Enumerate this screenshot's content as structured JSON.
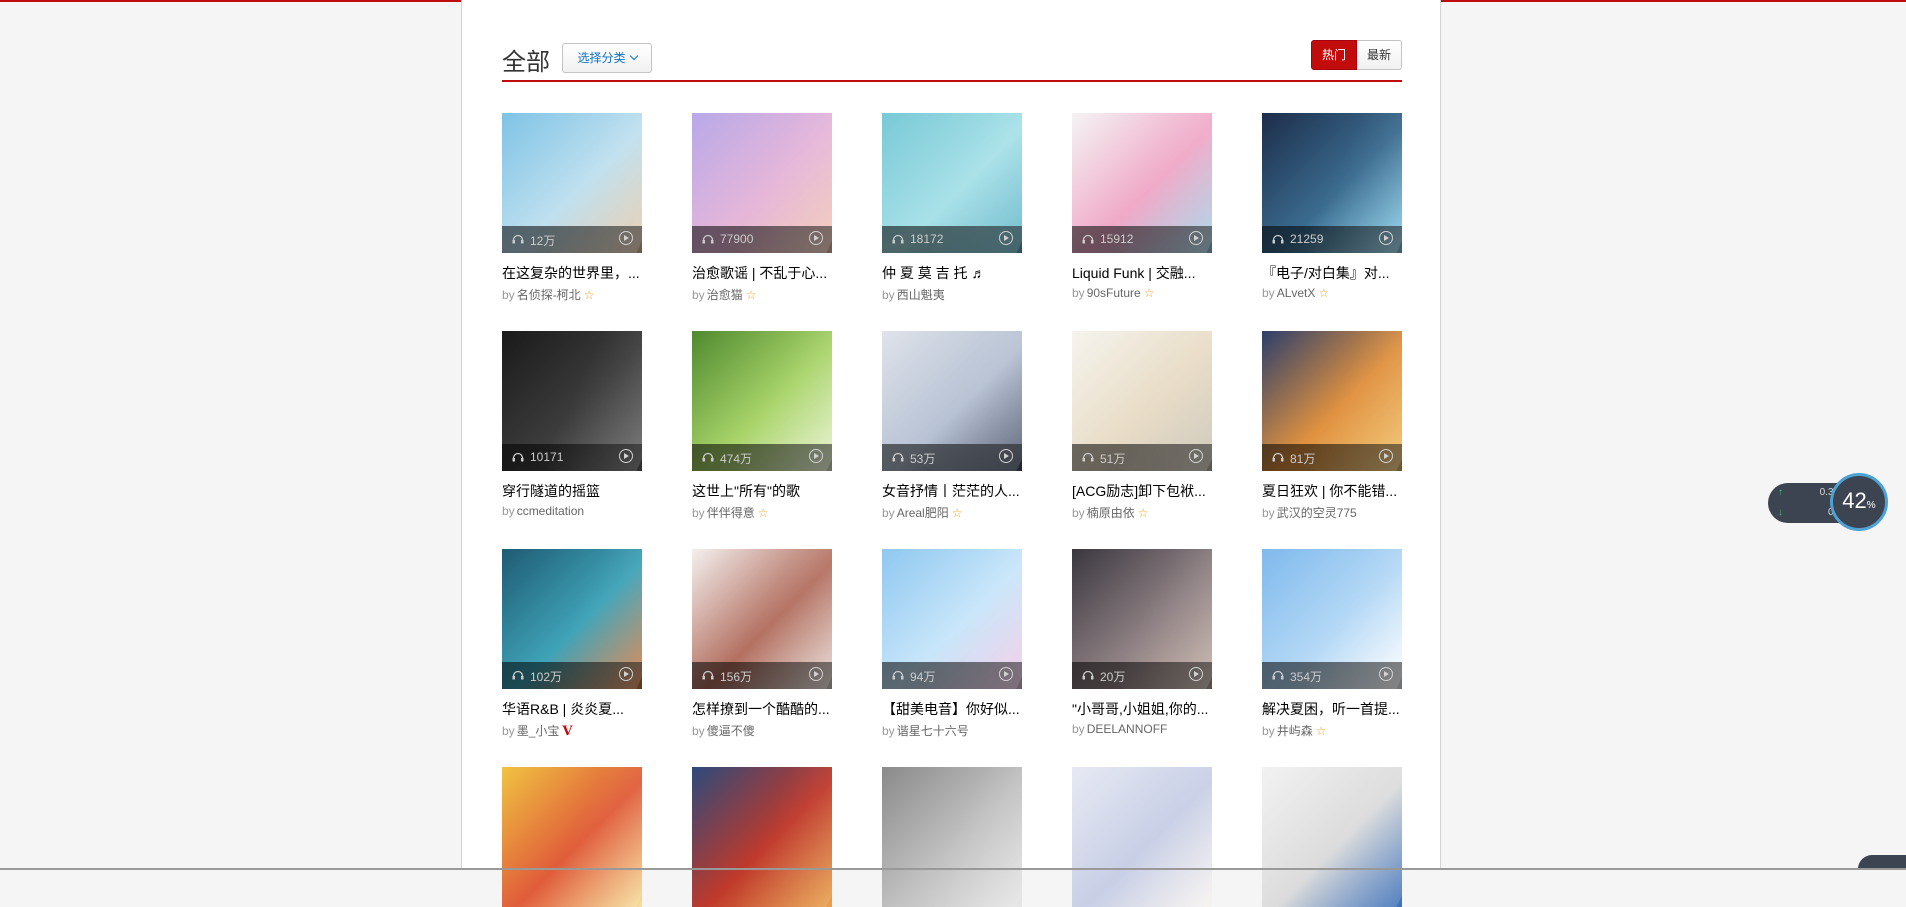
{
  "page": {
    "title": "全部",
    "category_button": "选择分类",
    "sort": {
      "hot": "热门",
      "new": "最新"
    }
  },
  "by_prefix": "by",
  "playlists": [
    {
      "name": "在这复杂的世界里，...",
      "count": "12万",
      "author": "名侦探-柯北",
      "badge": "star",
      "colors": [
        "#7fc3e6",
        "#bfe0ef",
        "#e9c8a8"
      ]
    },
    {
      "name": "治愈歌谣 | 不乱于心...",
      "count": "77900",
      "author": "治愈猫",
      "badge": "star",
      "colors": [
        "#b8a9e8",
        "#e6b6d9",
        "#f2c7b2"
      ]
    },
    {
      "name": "仲 夏 莫 吉 托 ♬",
      "count": "18172",
      "author": "西山魁夷",
      "badge": "",
      "colors": [
        "#78c9d6",
        "#a9e1e8",
        "#5fb3c8"
      ]
    },
    {
      "name": "Liquid Funk | 交融...",
      "count": "15912",
      "author": "90sFuture",
      "badge": "star",
      "colors": [
        "#f4f4f4",
        "#f0a9c8",
        "#9fd4e8"
      ]
    },
    {
      "name": "『电子/对白集』对...",
      "count": "21259",
      "author": "ALvetX",
      "badge": "star",
      "colors": [
        "#1d2d4a",
        "#3a6b8f",
        "#8fd6f0"
      ]
    },
    {
      "name": "穿行隧道的摇篮",
      "count": "10171",
      "author": "ccmeditation",
      "badge": "",
      "colors": [
        "#1a1a1a",
        "#3c3c3c",
        "#6a6a6a"
      ]
    },
    {
      "name": "这世上\"所有\"的歌",
      "count": "474万",
      "author": "伴伴得意",
      "badge": "star",
      "colors": [
        "#4f8a2f",
        "#a9d46a",
        "#e8f3d2"
      ]
    },
    {
      "name": "女音抒情丨茫茫的人...",
      "count": "53万",
      "author": "Areal肥阳",
      "badge": "star",
      "colors": [
        "#dfe3ea",
        "#b7c2d4",
        "#4a5368"
      ]
    },
    {
      "name": "[ACG励志]卸下包袱...",
      "count": "51万",
      "author": "楠原由依",
      "badge": "star",
      "colors": [
        "#f6f4ee",
        "#e8dcc6",
        "#c9c2b4"
      ]
    },
    {
      "name": "夏日狂欢 | 你不能错...",
      "count": "81万",
      "author": "武汉的空灵775",
      "badge": "",
      "colors": [
        "#2c3f6b",
        "#e0913f",
        "#f1c36a"
      ]
    },
    {
      "name": "华语R&B | 炎炎夏...",
      "count": "102万",
      "author": "墨_小宝",
      "badge": "vip",
      "colors": [
        "#1e5b73",
        "#3fa3b8",
        "#e07a3c"
      ]
    },
    {
      "name": "怎样撩到一个酷酷的...",
      "count": "156万",
      "author": "傻逼不傻",
      "badge": "",
      "colors": [
        "#f4f0ee",
        "#b37061",
        "#e8dcd6"
      ]
    },
    {
      "name": "【甜美电音】你好似...",
      "count": "94万",
      "author": "谐星七十六号",
      "badge": "",
      "colors": [
        "#8fc8f0",
        "#c8e6fa",
        "#f3c9e6"
      ]
    },
    {
      "name": "\"小哥哥,小姐姐,你的...",
      "count": "20万",
      "author": "DEELANNOFF",
      "badge": "",
      "colors": [
        "#3a3740",
        "#8d7f82",
        "#c8b3a8"
      ]
    },
    {
      "name": "解决夏困，听一首提...",
      "count": "354万",
      "author": "井屿森",
      "badge": "star",
      "colors": [
        "#7fb9ec",
        "#b4d8f6",
        "#ffffff"
      ]
    },
    {
      "name": "",
      "count": "",
      "author": "",
      "badge": "",
      "colors": [
        "#f0c341",
        "#e05c3a",
        "#f6df9a"
      ]
    },
    {
      "name": "",
      "count": "",
      "author": "",
      "badge": "",
      "colors": [
        "#2c4a7b",
        "#c0392b",
        "#e8a24a"
      ]
    },
    {
      "name": "",
      "count": "",
      "author": "",
      "badge": "",
      "colors": [
        "#8a8a8a",
        "#c2c2c2",
        "#e6e6e6"
      ]
    },
    {
      "name": "",
      "count": "",
      "author": "",
      "badge": "",
      "colors": [
        "#e7eaf4",
        "#c8cfe6",
        "#f7f3f0"
      ]
    },
    {
      "name": "",
      "count": "",
      "author": "",
      "badge": "",
      "colors": [
        "#f2f2f2",
        "#dcdcdc",
        "#3b6fb8"
      ]
    }
  ],
  "network": {
    "up": "0.3K/s",
    "down": "0K/s",
    "percent": "42",
    "percent_sign": "%"
  },
  "colors": {
    "accent": "#c20c0c",
    "link": "#0c73c2",
    "star": "#e8a122"
  }
}
